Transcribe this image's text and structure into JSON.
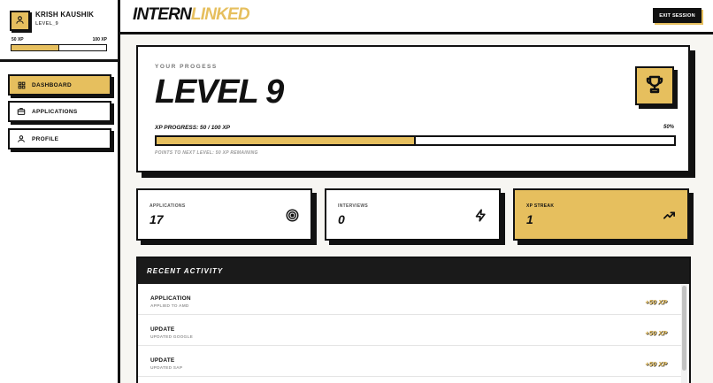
{
  "app": {
    "logo_part1": "INTERN",
    "logo_part2": "LINKED"
  },
  "user": {
    "name": "KRISH KAUSHIK",
    "level": "LEVEL_9",
    "xp_min": "50 XP",
    "xp_max": "100 XP",
    "xp_fraction": 0.5
  },
  "nav": {
    "items": [
      {
        "label": "DASHBOARD",
        "icon": "grid-icon",
        "active": true
      },
      {
        "label": "APPLICATIONS",
        "icon": "briefcase-icon",
        "active": false
      },
      {
        "label": "PROFILE",
        "icon": "user-icon",
        "active": false
      }
    ]
  },
  "topbar": {
    "exit_label": "EXIT SESSION"
  },
  "progress": {
    "heading": "YOUR PROGESS",
    "level": "LEVEL 9",
    "xp_label": "XP PROGRESS: 50 / 100 XP",
    "percent_label": "50%",
    "percent": 50,
    "points_next": "POINTS TO NEXT LEVEL: 50 XP REMAINING",
    "icon": "trophy-icon"
  },
  "stats": [
    {
      "label": "APPLICATIONS",
      "value": "17",
      "icon": "target-icon"
    },
    {
      "label": "INTERVIEWS",
      "value": "0",
      "icon": "lightning-icon"
    },
    {
      "label": "XP STREAK",
      "value": "1",
      "icon": "trending-up-icon"
    }
  ],
  "activity": {
    "heading": "RECENT ACTIVITY",
    "items": [
      {
        "title": "APPLICATION",
        "subtitle": "APPLIED TO AMD",
        "xp": "+50 XP"
      },
      {
        "title": "UPDATE",
        "subtitle": "UPDATED GOOGLE",
        "xp": "+50 XP"
      },
      {
        "title": "UPDATE",
        "subtitle": "UPDATED SAP",
        "xp": "+50 XP"
      }
    ]
  },
  "colors": {
    "accent": "#e6bf5e",
    "ink": "#111111",
    "panel_dark": "#1a1a1a"
  }
}
